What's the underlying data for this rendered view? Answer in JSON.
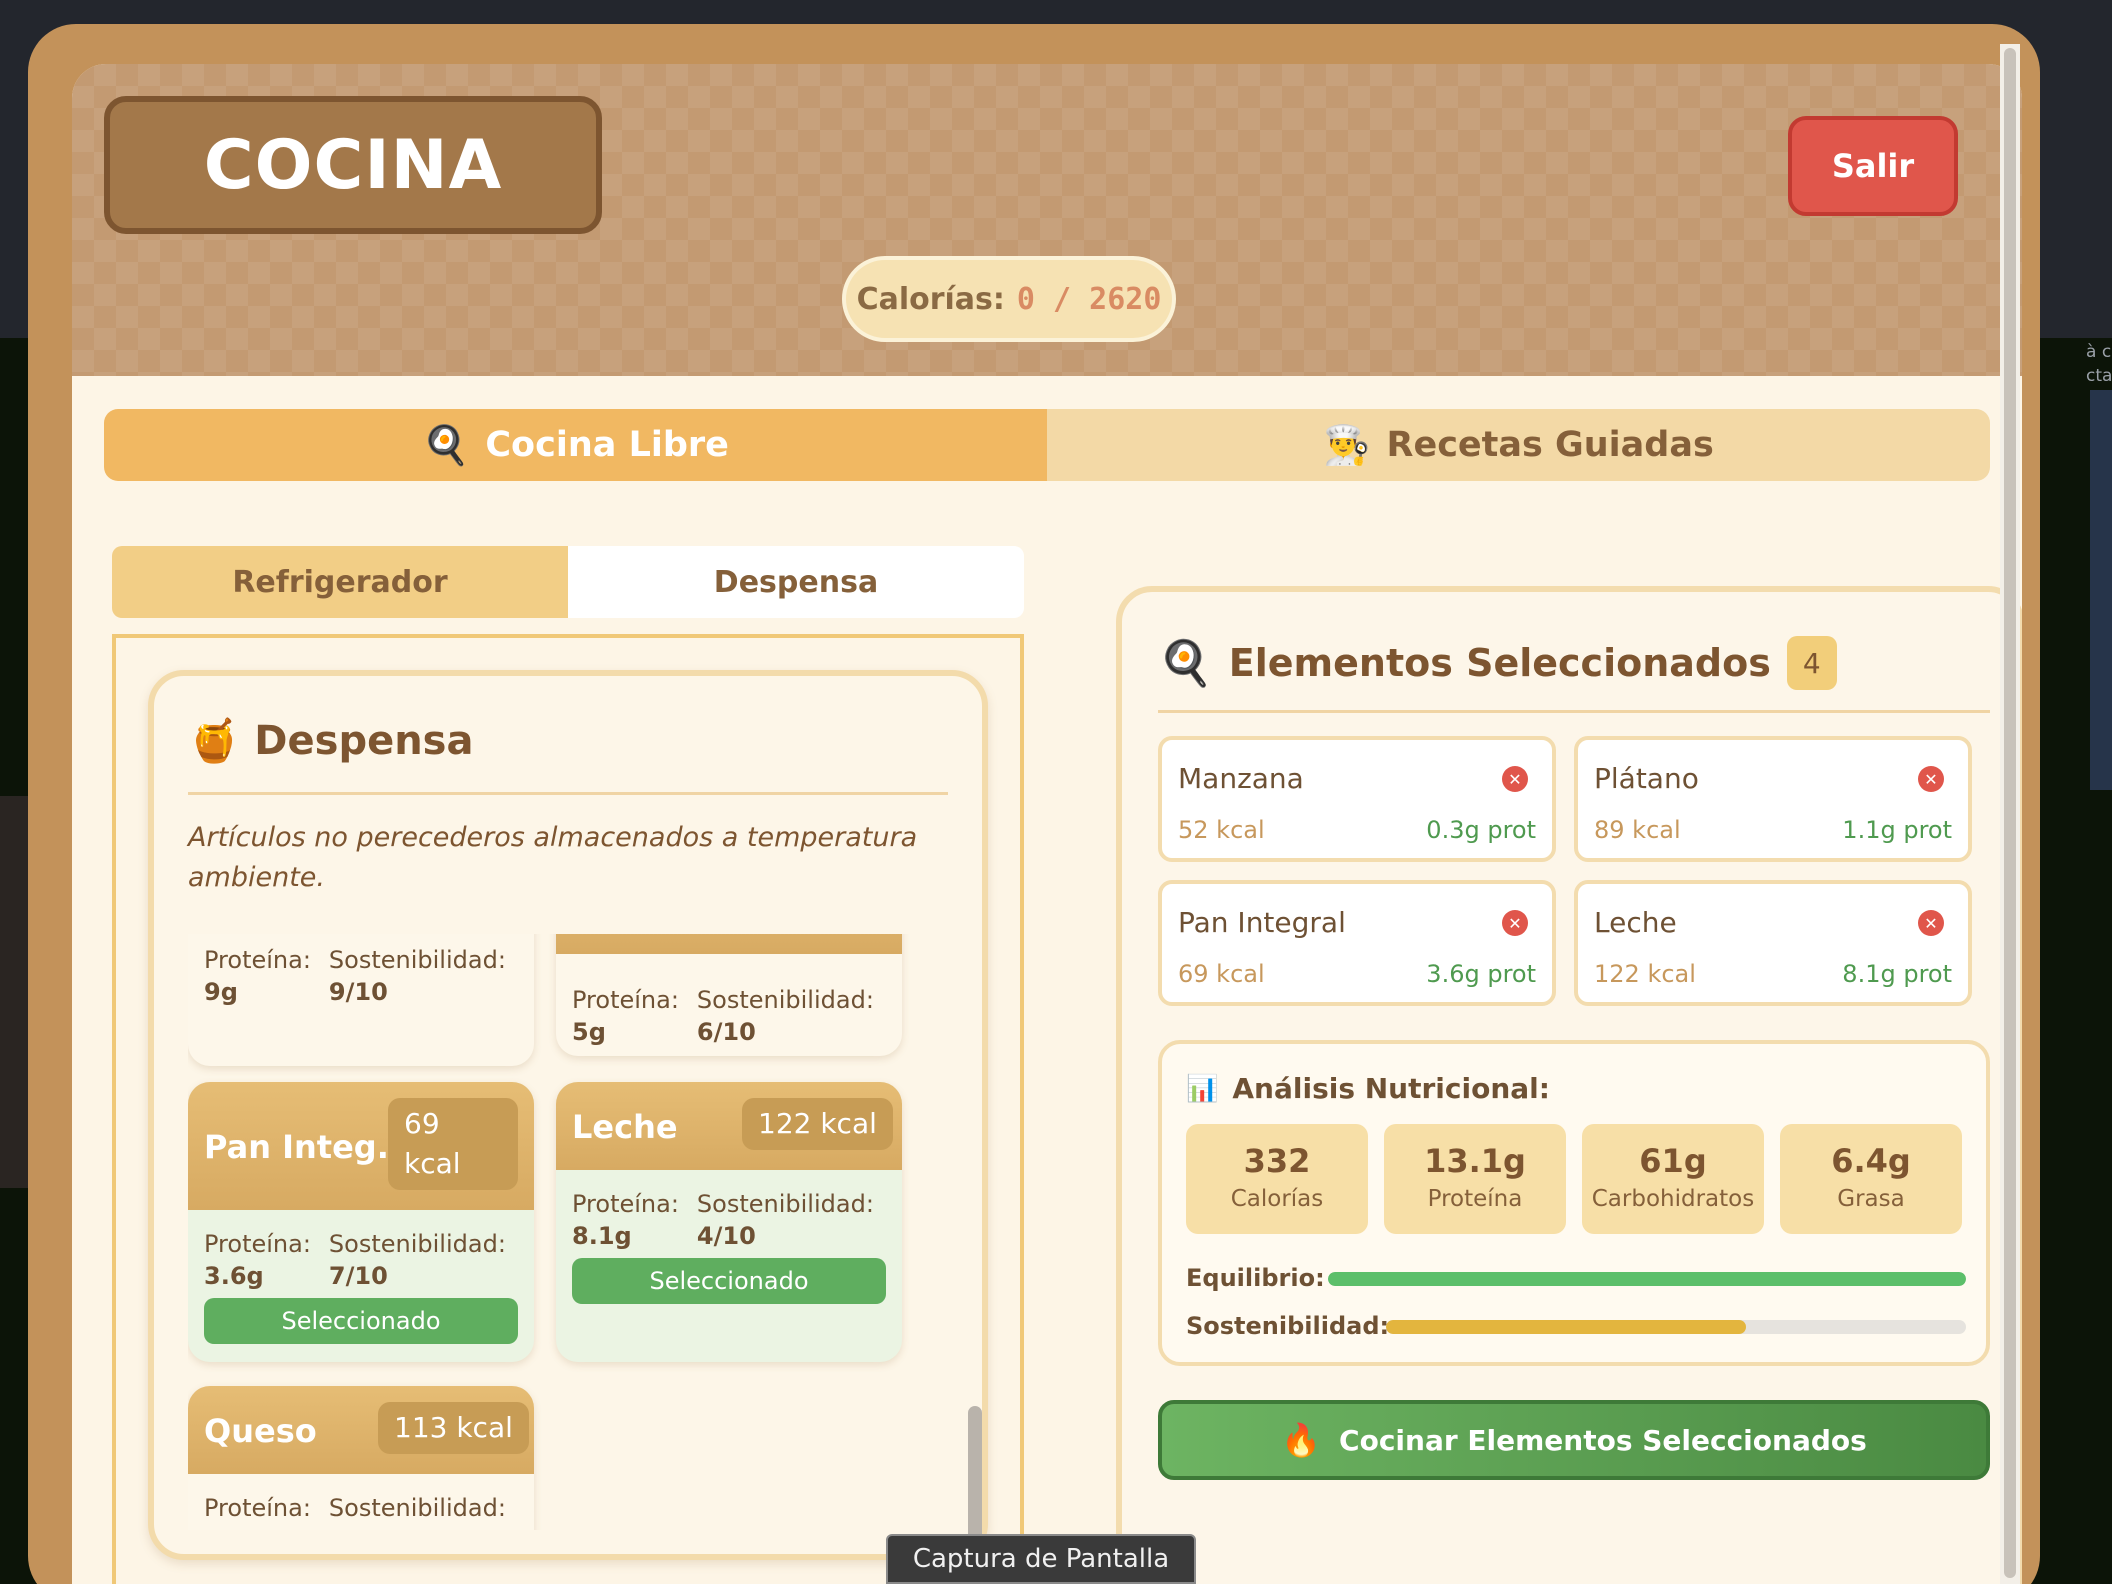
{
  "background": {
    "side_text_lines": [
      "à c",
      "cta"
    ]
  },
  "header": {
    "title": "COCINA",
    "exit_label": "Salir",
    "calories_label": "Calorías:",
    "calories_value": "0 / 2620"
  },
  "main_tabs": [
    {
      "icon": "🍳",
      "label": "Cocina Libre",
      "active": true
    },
    {
      "icon": "👨‍🍳",
      "label": "Recetas Guiadas",
      "active": false
    }
  ],
  "storage_tabs": [
    {
      "label": "Refrigerador",
      "active": true
    },
    {
      "label": "Despensa",
      "active": false
    }
  ],
  "pantry": {
    "icon": "🍯",
    "title": "Despensa",
    "description": "Artículos no perecederos almacenados a temperatura ambiente.",
    "protein_label": "Proteína:",
    "sustainability_label": "Sostenibilidad:",
    "selected_label": "Seleccionado",
    "items": [
      {
        "name": "",
        "kcal": "",
        "protein": "9g",
        "sustainability": "9/10",
        "selected": false
      },
      {
        "name": "",
        "kcal": "",
        "protein": "5g",
        "sustainability": "6/10",
        "selected": false
      },
      {
        "name": "Pan Integ...",
        "kcal": "69 kcal",
        "protein": "3.6g",
        "sustainability": "7/10",
        "selected": true
      },
      {
        "name": "Leche",
        "kcal": "122 kcal",
        "protein": "8.1g",
        "sustainability": "4/10",
        "selected": true
      },
      {
        "name": "Queso",
        "kcal": "113 kcal",
        "protein": "",
        "sustainability": "",
        "selected": false
      }
    ]
  },
  "selection": {
    "icon": "🍳",
    "title": "Elementos Seleccionados",
    "count": "4",
    "items": [
      {
        "name": "Manzana",
        "kcal": "52 kcal",
        "protein": "0.3g prot"
      },
      {
        "name": "Plátano",
        "kcal": "89 kcal",
        "protein": "1.1g prot"
      },
      {
        "name": "Pan Integral",
        "kcal": "69 kcal",
        "protein": "3.6g prot"
      },
      {
        "name": "Leche",
        "kcal": "122 kcal",
        "protein": "8.1g prot"
      }
    ]
  },
  "analysis": {
    "icon": "📊",
    "title": "Análisis Nutricional:",
    "stats": [
      {
        "value": "332",
        "label": "Calorías"
      },
      {
        "value": "13.1g",
        "label": "Proteína"
      },
      {
        "value": "61g",
        "label": "Carbohidratos"
      },
      {
        "value": "6.4g",
        "label": "Grasa"
      }
    ],
    "balance_label": "Equilibrio:",
    "balance_level": 1.0,
    "sustainability_label": "Sostenibilidad:",
    "sustainability_level": 0.62,
    "colors": {
      "balance": "#5cbf6a",
      "sustainability": "#e3b53e"
    }
  },
  "cook_button": {
    "icon": "🔥",
    "label": "Cocinar Elementos Seleccionados"
  },
  "tooltip": "Captura de Pantalla"
}
